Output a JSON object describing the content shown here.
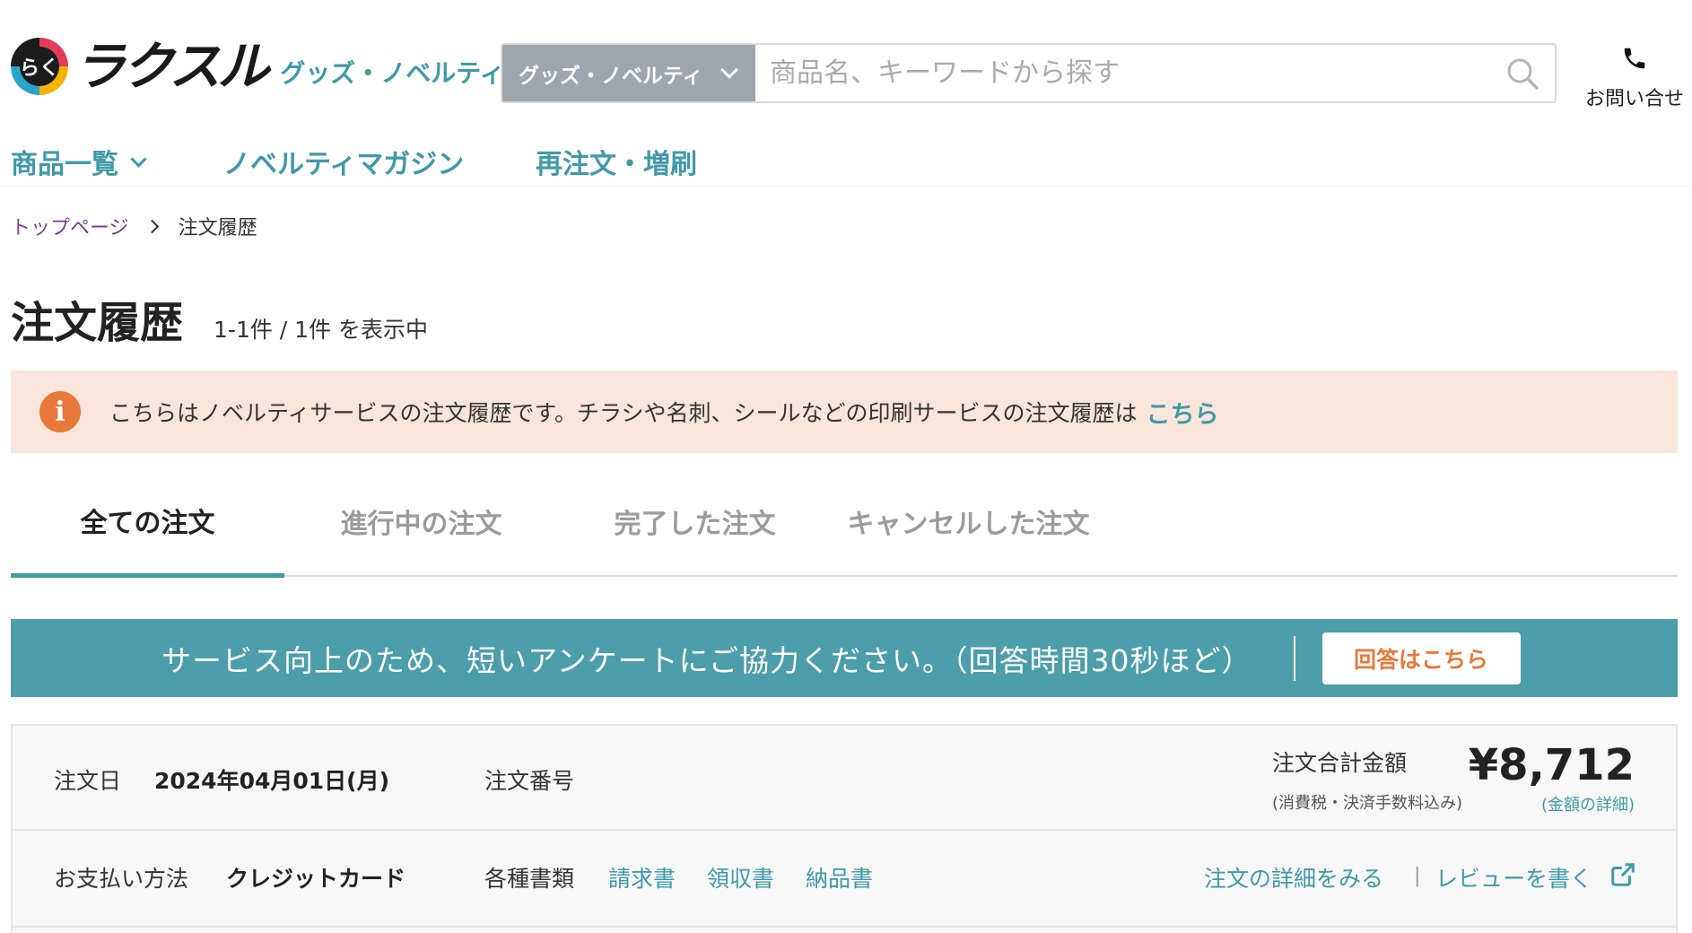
{
  "header": {
    "logo_mark": "らく",
    "logo_text": "ラクスル",
    "logo_sub": "グッズ・ノベルティ",
    "search": {
      "category": "グッズ・ノベルティ",
      "placeholder": "商品名、キーワードから探す"
    },
    "contact_label": "お問い合せ"
  },
  "nav": {
    "items": [
      {
        "label": "商品一覧"
      },
      {
        "label": "ノベルティマガジン"
      },
      {
        "label": "再注文・増刷"
      }
    ]
  },
  "breadcrumb": {
    "home": "トップページ",
    "current": "注文履歴"
  },
  "title": {
    "main": "注文履歴",
    "count": "1-1件 / 1件 を表示中"
  },
  "notice": {
    "text": "こちらはノベルティサービスの注文履歴です。チラシや名刺、シールなどの印刷サービスの注文履歴は",
    "link": "こちら"
  },
  "tabs": [
    {
      "label": "全ての注文",
      "active": true
    },
    {
      "label": "進行中の注文"
    },
    {
      "label": "完了した注文"
    },
    {
      "label": "キャンセルした注文"
    }
  ],
  "survey": {
    "text": "サービス向上のため、短いアンケートにご協力ください。（回答時間30秒ほど）",
    "button": "回答はこちら"
  },
  "order": {
    "date_label": "注文日",
    "date_value": "2024年04月01日(月)",
    "number_label": "注文番号",
    "number_value": "",
    "total_label": "注文合計金額",
    "total_note": "(消費税・決済手数料込み)",
    "total_amount": "¥8,712",
    "total_detail": "(金額の詳細)",
    "payment_label": "お支払い方法",
    "payment_value": "クレジットカード",
    "docs_label": "各種書類",
    "docs": [
      "請求書",
      "領収書",
      "納品書"
    ],
    "detail_link": "注文の詳細をみる",
    "separator": "|",
    "review_link": "レビューを書く"
  },
  "colors": {
    "accent": "#3f9aa8",
    "survey_bg": "#4b9eaa",
    "notice_bg": "#fae5da",
    "info_orange": "#e8793a",
    "breadcrumb_link": "#7a3d93"
  }
}
